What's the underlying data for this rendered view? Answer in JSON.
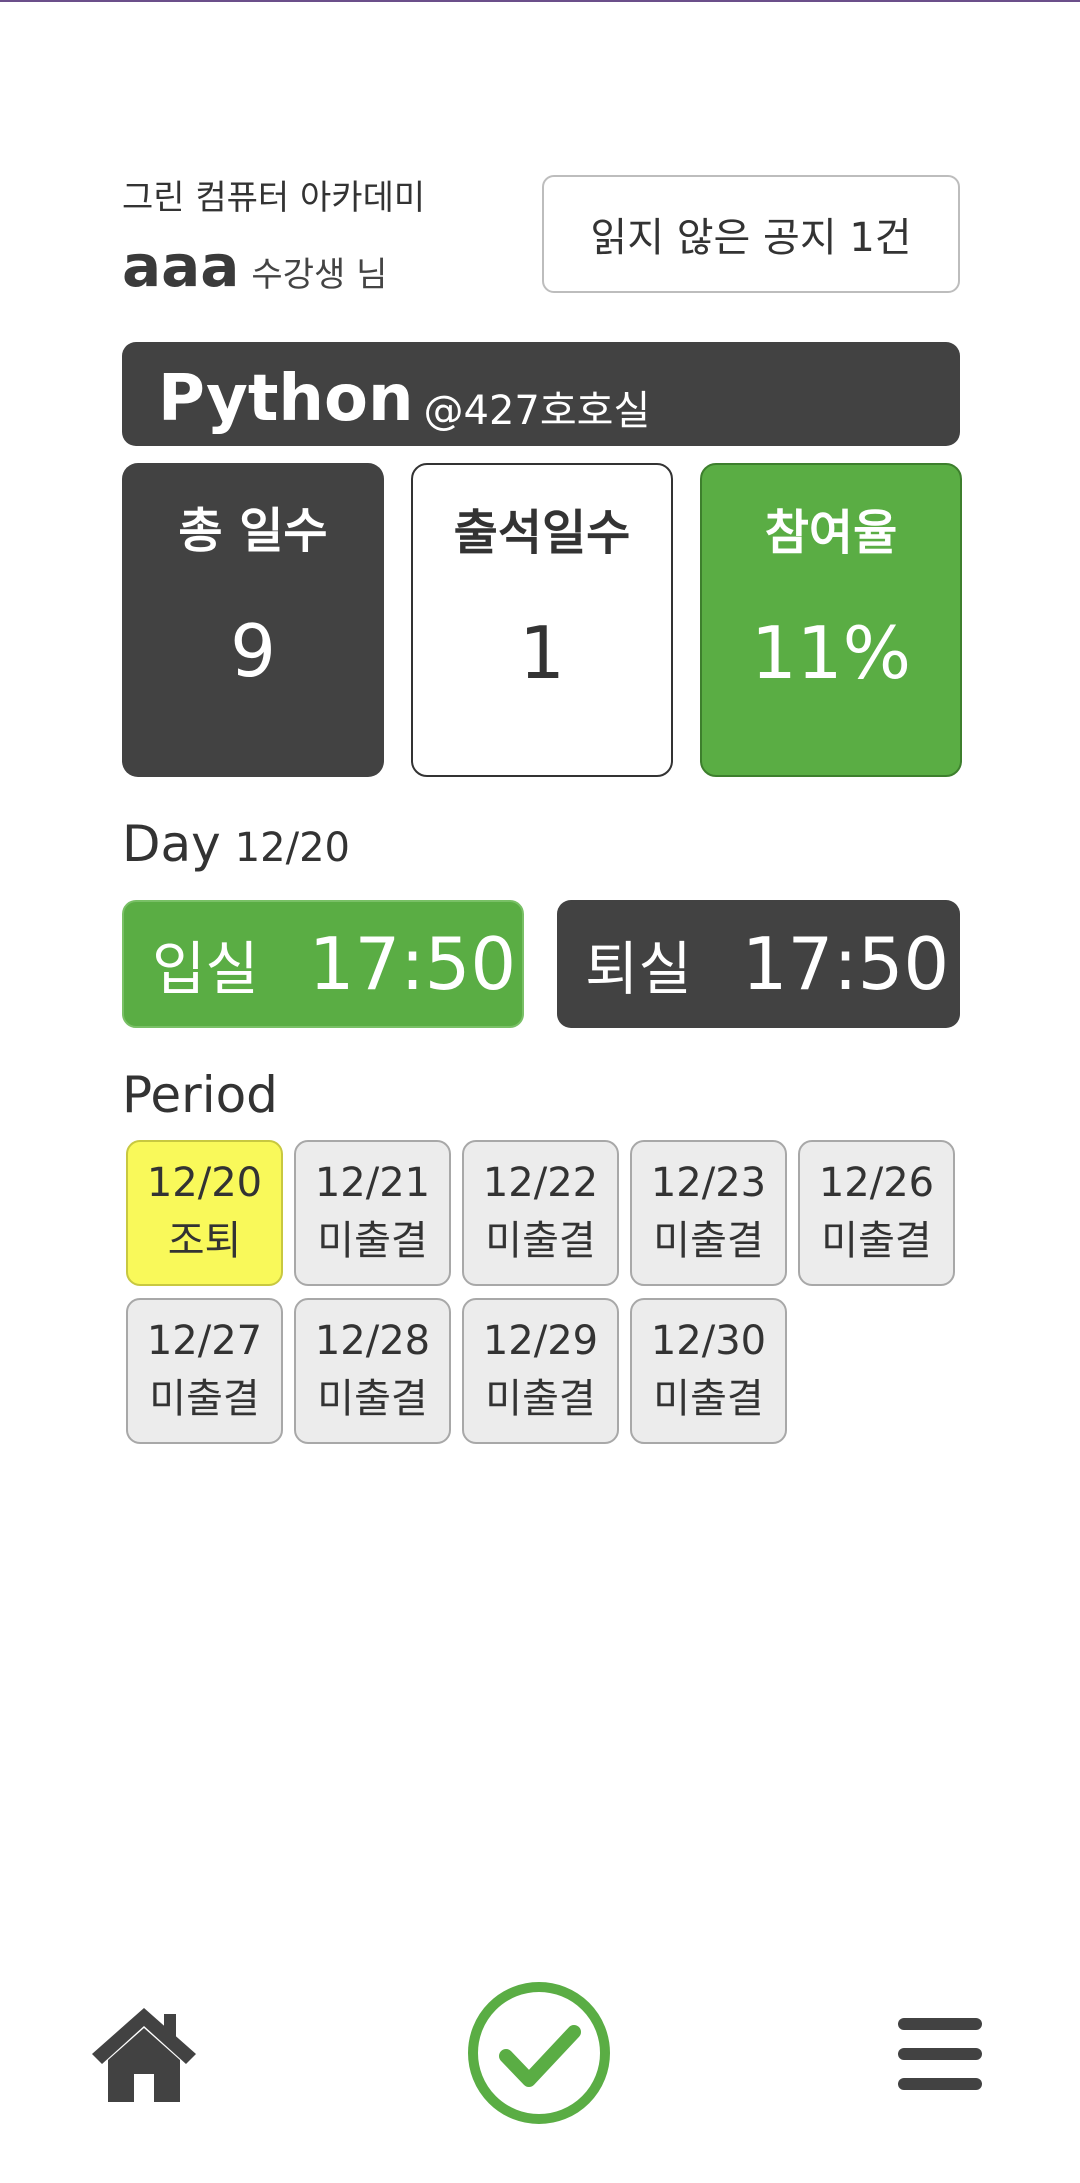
{
  "header": {
    "academy": "그린 컴퓨터 아카데미",
    "user_name": "aaa",
    "user_suffix": "수강생 님",
    "notice_button": "읽지 않은 공지 1건"
  },
  "course": {
    "name": "Python",
    "room": "@427호호실"
  },
  "stats": {
    "total_label": "총 일수",
    "total_value": "9",
    "attend_label": "출석일수",
    "attend_value": "1",
    "rate_label": "참여율",
    "rate_value": "11%"
  },
  "day": {
    "label": "Day",
    "date": "12/20",
    "checkin_label": "입실",
    "checkin_time": "17:50",
    "checkout_label": "퇴실",
    "checkout_time": "17:50"
  },
  "period": {
    "label": "Period",
    "items": [
      {
        "date": "12/20",
        "status": "조퇴"
      },
      {
        "date": "12/21",
        "status": "미출결"
      },
      {
        "date": "12/22",
        "status": "미출결"
      },
      {
        "date": "12/23",
        "status": "미출결"
      },
      {
        "date": "12/26",
        "status": "미출결"
      },
      {
        "date": "12/27",
        "status": "미출결"
      },
      {
        "date": "12/28",
        "status": "미출결"
      },
      {
        "date": "12/29",
        "status": "미출결"
      },
      {
        "date": "12/30",
        "status": "미출결"
      }
    ]
  },
  "nav": {
    "home_icon": "home-icon",
    "check_icon": "check-circle-icon",
    "menu_icon": "hamburger-menu-icon"
  },
  "colors": {
    "green": "#5aad44",
    "dark": "#424242",
    "highlight": "#f9f95a",
    "cell_bg": "#ececec"
  }
}
